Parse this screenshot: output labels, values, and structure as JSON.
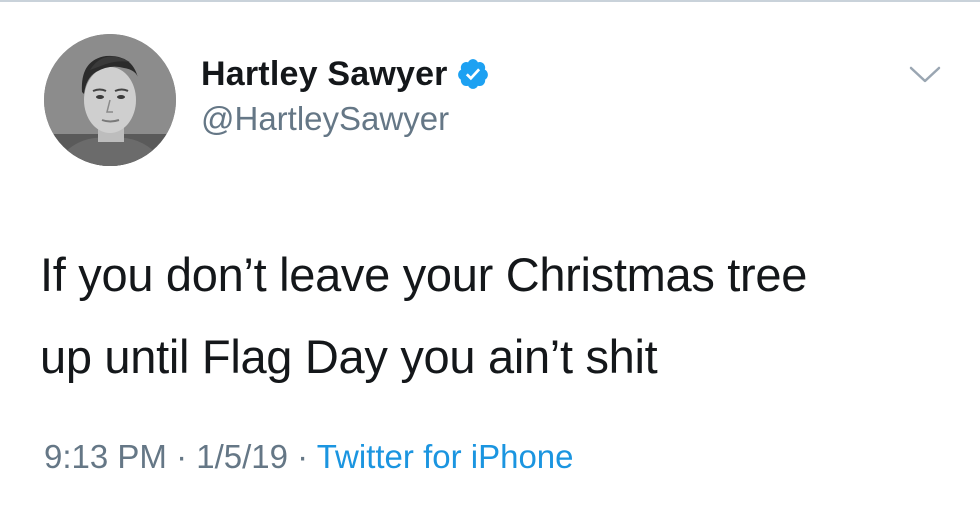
{
  "tweet": {
    "display_name": "Hartley Sawyer",
    "handle": "@HartleySawyer",
    "verified_icon": "verified-badge-icon",
    "menu_icon": "chevron-down-icon",
    "text_lines": [
      "If you don’t leave your Christmas tree",
      "up until Flag Day you ain’t shit"
    ],
    "time": "9:13 PM",
    "separator": " · ",
    "date": "1/5/19",
    "source": "Twitter for iPhone"
  },
  "colors": {
    "verified_blue": "#1da1f2",
    "link_blue": "#1b95e0",
    "secondary_gray": "#657786",
    "text_dark": "#14171a"
  }
}
